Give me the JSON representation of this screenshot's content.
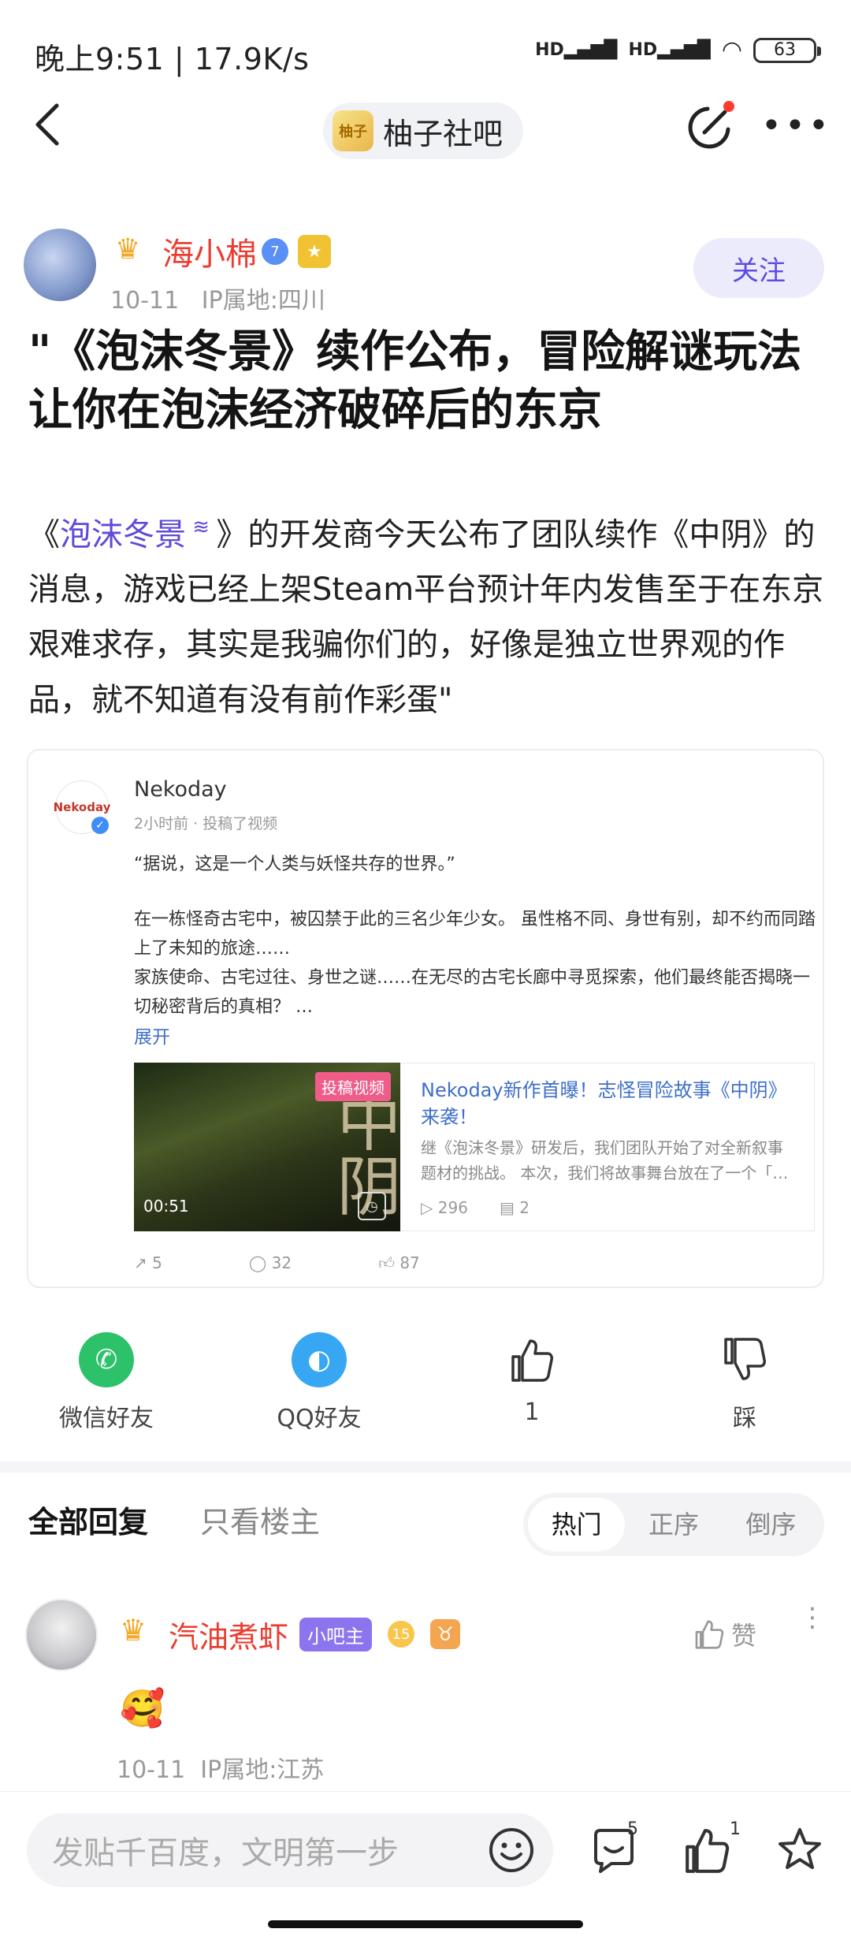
{
  "status_bar": {
    "time": "晚上9:51 | 17.9K/s",
    "battery": "63"
  },
  "nav": {
    "forum_name": "柚子社吧",
    "forum_logo_text": "柚子"
  },
  "author": {
    "name": "海小棉",
    "level": "7",
    "date": "10-11",
    "ip": "IP属地:四川",
    "follow_label": "关注"
  },
  "post": {
    "title": "\"《泡沫冬景》续作公布，冒险解谜玩法让你在泡沫经济破碎后的东京",
    "body_prefix": "《",
    "body_link": "泡沫冬景",
    "body_rest": "》的开发商今天公布了团队续作《中阴》的消息，游戏已经上架Steam平台预计年内发售至于在东京艰难求存，其实是我骗你们的，好像是独立世界观的作品，就不知道有没有前作彩蛋\""
  },
  "embed": {
    "logo_text": "Nekoday",
    "name": "Nekoday",
    "meta": "2小时前 · 投稿了视频",
    "quote": "“据说，这是一个人类与妖怪共存的世界。”",
    "body": "在一栋怪奇古宅中，被囚禁于此的三名少年少女。 虽性格不同、身世有别，却不约而同踏上了未知的旅途……\n家族使命、古宅过往、身世之谜……在无尽的古宅长廊中寻觅探索，他们最终能否揭晓一切秘密背后的真相？ …",
    "expand": "展开",
    "video": {
      "tag": "投稿视频",
      "duration": "00:51",
      "cover_text": "中阴",
      "title": "Nekoday新作首曝！志怪冒险故事《中阴》来袭！",
      "desc": "继《泡沫冬景》研发后，我们团队开始了对全新叙事题材的挑战。 本次，我们将故事舞台放在了一个「…",
      "plays": "296",
      "comments": "2"
    },
    "stats": {
      "shares": "5",
      "comments": "32",
      "likes": "87"
    }
  },
  "share_row": {
    "wechat": "微信好友",
    "qq": "QQ好友",
    "like_count": "1",
    "dislike": "踩"
  },
  "replies": {
    "tab_all": "全部回复",
    "tab_op": "只看楼主",
    "sort": [
      "热门",
      "正序",
      "倒序"
    ],
    "sort_active": "热门"
  },
  "comment": {
    "name": "汽油煮虾",
    "badge": "小吧主",
    "level": "15",
    "zodiac": "♉",
    "like_label": "赞",
    "emoji": "🥰",
    "date": "10-11",
    "ip": "IP属地:江苏"
  },
  "bottom": {
    "input_placeholder": "发贴千百度，文明第一步",
    "comment_count": "5",
    "like_count": "1"
  },
  "colors": {
    "accent": "#5e4bd8",
    "username_red": "#ea3d31",
    "link_blue": "#3e6fc9"
  }
}
